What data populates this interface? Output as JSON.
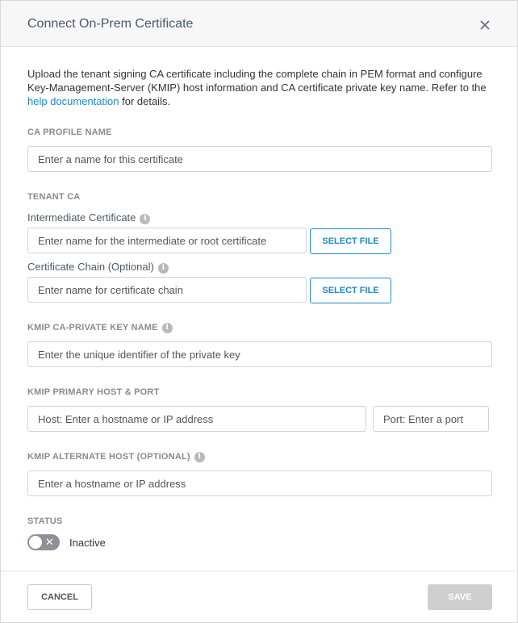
{
  "dialog": {
    "title": "Connect On-Prem Certificate",
    "intro_before": "Upload the tenant signing CA certificate including the complete chain in PEM format and configure Key-Management-Server (KMIP) host information and CA certificate private key name. Refer to the ",
    "intro_link": "help documentation",
    "intro_after": " for details."
  },
  "ca_profile": {
    "label": "CA PROFILE NAME",
    "placeholder": "Enter a name for this certificate"
  },
  "tenant_ca": {
    "label": "TENANT CA",
    "intermediate_label": "Intermediate Certificate",
    "intermediate_placeholder": "Enter name for the intermediate or root certificate",
    "chain_label": "Certificate Chain (Optional)",
    "chain_placeholder": "Enter name for certificate chain",
    "select_file_label": "SELECT FILE"
  },
  "kmip_key": {
    "label": "KMIP CA-PRIVATE KEY NAME",
    "placeholder": "Enter the unique identifier of the private key"
  },
  "kmip_primary": {
    "label": "KMIP PRIMARY HOST & PORT",
    "host_placeholder": "Host: Enter a hostname or IP address",
    "port_placeholder": "Port: Enter a port"
  },
  "kmip_alternate": {
    "label": "KMIP ALTERNATE HOST (OPTIONAL)",
    "placeholder": "Enter a hostname or IP address"
  },
  "status": {
    "label": "STATUS",
    "value": "Inactive"
  },
  "footer": {
    "cancel_label": "CANCEL",
    "save_label": "SAVE"
  },
  "icons": {
    "close": "close-icon",
    "info": "info-icon",
    "info_glyph": "i"
  },
  "colors": {
    "accent": "#1b8ac6",
    "disabled": "#cfcfcf"
  }
}
